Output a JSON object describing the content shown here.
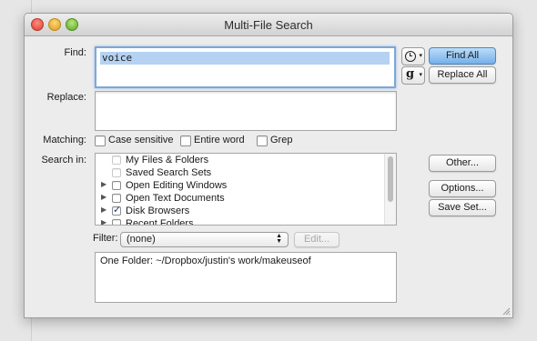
{
  "window": {
    "title": "Multi-File Search"
  },
  "find": {
    "label": "Find:",
    "value": "voice"
  },
  "replace": {
    "label": "Replace:",
    "value": ""
  },
  "buttons": {
    "find_all": "Find All",
    "replace_all": "Replace All",
    "other": "Other...",
    "options": "Options...",
    "save_set": "Save Set...",
    "edit": "Edit..."
  },
  "matching": {
    "label": "Matching:",
    "options": [
      {
        "label": "Case sensitive",
        "checked": false
      },
      {
        "label": "Entire word",
        "checked": false
      },
      {
        "label": "Grep",
        "checked": false
      }
    ]
  },
  "search_in": {
    "label": "Search in:",
    "items": [
      {
        "label": "My Files & Folders",
        "checked": false,
        "expandable": false
      },
      {
        "label": "Saved Search Sets",
        "checked": false,
        "expandable": false
      },
      {
        "label": "Open Editing Windows",
        "checked": false,
        "expandable": true
      },
      {
        "label": "Open Text Documents",
        "checked": false,
        "expandable": true
      },
      {
        "label": "Disk Browsers",
        "checked": true,
        "expandable": true
      },
      {
        "label": "Recent Folders",
        "checked": false,
        "expandable": true
      }
    ]
  },
  "filter": {
    "label": "Filter:",
    "selected": "(none)"
  },
  "folder_info": "One Folder: ~/Dropbox/justin's work/makeuseof",
  "icons": {
    "history": "clock-icon",
    "grep_menu": "g-icon"
  }
}
